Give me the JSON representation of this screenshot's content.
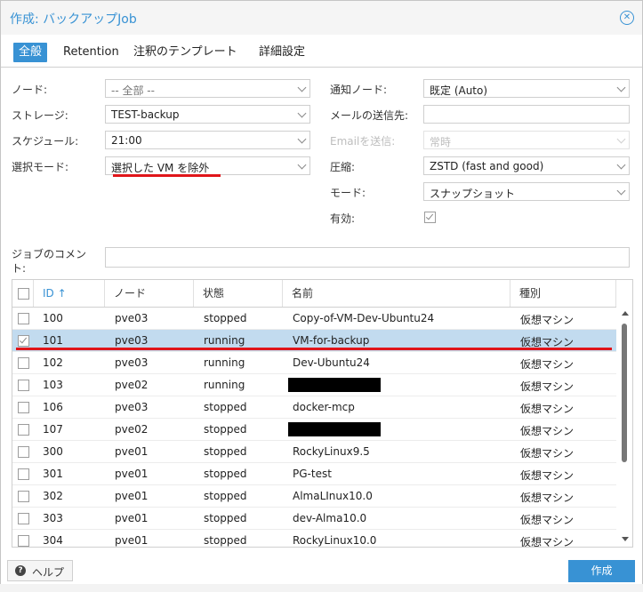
{
  "dialog": {
    "title": "作成: バックアップJob"
  },
  "tabs": [
    "全般",
    "Retention",
    "注釈のテンプレート",
    "詳細設定"
  ],
  "left_fields": {
    "node": {
      "label": "ノード:",
      "value": "-- 全部 --"
    },
    "storage": {
      "label": "ストレージ:",
      "value": "TEST-backup"
    },
    "schedule": {
      "label": "スケジュール:",
      "value": "21:00"
    },
    "selection_mode": {
      "label": "選択モード:",
      "value": "選択した VM を除外"
    }
  },
  "right_fields": {
    "notify_node": {
      "label": "通知ノード:",
      "value": "既定 (Auto)"
    },
    "mail_to": {
      "label": "メールの送信先:",
      "value": ""
    },
    "email_send": {
      "label": "Emailを送信:",
      "value": "常時"
    },
    "compression": {
      "label": "圧縮:",
      "value": "ZSTD (fast and good)"
    },
    "mode": {
      "label": "モード:",
      "value": "スナップショット"
    },
    "enabled": {
      "label": "有効:",
      "checked": true
    }
  },
  "comment": {
    "label_line1": "ジョブのコメン",
    "label_line2": "ト:",
    "value": ""
  },
  "grid": {
    "headers": {
      "id": "ID",
      "sort_arrow": "↑",
      "node": "ノード",
      "status": "状態",
      "name": "名前",
      "type": "種別"
    },
    "rows": [
      {
        "id": "100",
        "node": "pve03",
        "status": "stopped",
        "name": "Copy-of-VM-Dev-Ubuntu24",
        "type": "仮想マシン",
        "checked": false
      },
      {
        "id": "101",
        "node": "pve03",
        "status": "running",
        "name": "VM-for-backup",
        "type": "仮想マシン",
        "checked": true
      },
      {
        "id": "102",
        "node": "pve03",
        "status": "running",
        "name": "Dev-Ubuntu24",
        "type": "仮想マシン",
        "checked": false
      },
      {
        "id": "103",
        "node": "pve02",
        "status": "running",
        "name": "",
        "type": "仮想マシン",
        "checked": false,
        "redacted": true
      },
      {
        "id": "106",
        "node": "pve03",
        "status": "stopped",
        "name": "docker-mcp",
        "type": "仮想マシン",
        "checked": false
      },
      {
        "id": "107",
        "node": "pve02",
        "status": "stopped",
        "name": "",
        "type": "仮想マシン",
        "checked": false,
        "redacted": true
      },
      {
        "id": "300",
        "node": "pve01",
        "status": "stopped",
        "name": "RockyLinux9.5",
        "type": "仮想マシン",
        "checked": false
      },
      {
        "id": "301",
        "node": "pve01",
        "status": "stopped",
        "name": "PG-test",
        "type": "仮想マシン",
        "checked": false
      },
      {
        "id": "302",
        "node": "pve01",
        "status": "stopped",
        "name": "AlmaLInux10.0",
        "type": "仮想マシン",
        "checked": false
      },
      {
        "id": "303",
        "node": "pve01",
        "status": "stopped",
        "name": "dev-Alma10.0",
        "type": "仮想マシン",
        "checked": false
      },
      {
        "id": "304",
        "node": "pve01",
        "status": "stopped",
        "name": "RockyLinux10.0",
        "type": "仮想マシン",
        "checked": false
      }
    ]
  },
  "footer": {
    "help_label": "ヘルプ",
    "create_label": "作成"
  },
  "colors": {
    "accent": "#3892d4",
    "highlight": "#e0151a",
    "selected_row": "#c2dbef"
  }
}
